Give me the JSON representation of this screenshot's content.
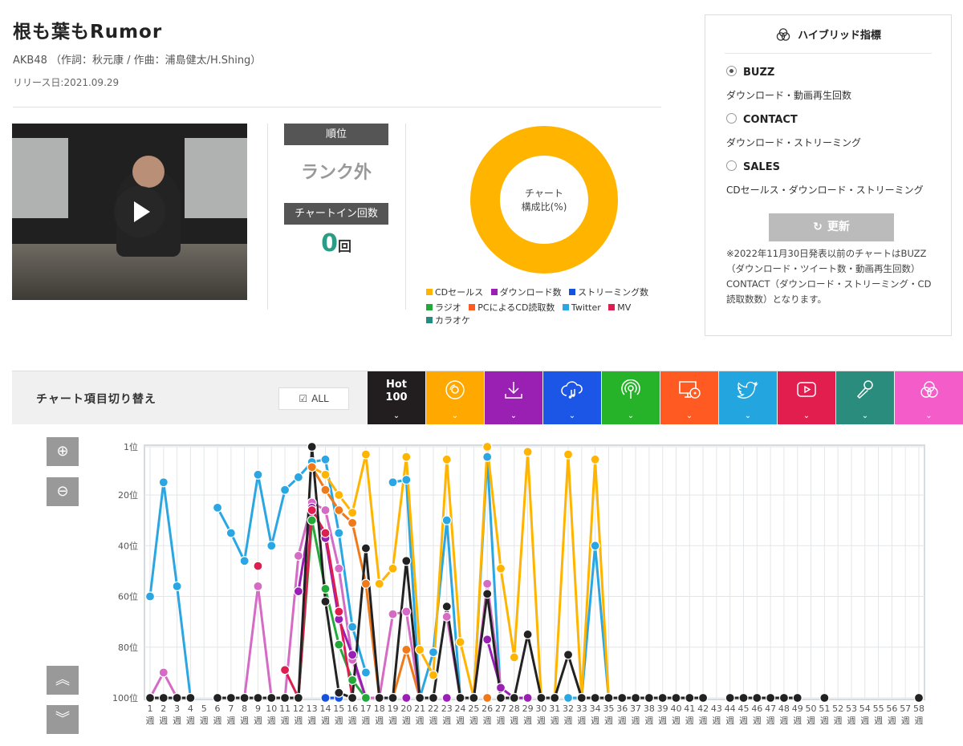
{
  "song": {
    "title": "根も葉もRumor",
    "artist_line": "AKB48 （作詞：秋元康 / 作曲：浦島健太/H.Shing）",
    "release": "リリース日:2021.09.29"
  },
  "rank": {
    "header": "順位",
    "value": "ランク外",
    "count_header": "チャートイン回数",
    "count": "0",
    "count_unit": "回"
  },
  "composition": {
    "label1": "チャート",
    "label2": "構成比(%)",
    "ring_color": "#ffb400",
    "legend": [
      {
        "label": "CDセールス",
        "color": "#ffb400"
      },
      {
        "label": "ダウンロード数",
        "color": "#9b1fb5"
      },
      {
        "label": "ストリーミング数",
        "color": "#1652e0"
      },
      {
        "label": "ラジオ",
        "color": "#23a83a"
      },
      {
        "label": "PCによるCD読取数",
        "color": "#ff5a1f"
      },
      {
        "label": "Twitter",
        "color": "#2aa7e2"
      },
      {
        "label": "MV",
        "color": "#de1d50"
      },
      {
        "label": "カラオケ",
        "color": "#248c7e"
      }
    ]
  },
  "hybrid": {
    "title": "ハイブリッド指標",
    "options": [
      {
        "label": "BUZZ",
        "desc": "ダウンロード・動画再生回数",
        "selected": true
      },
      {
        "label": "CONTACT",
        "desc": "ダウンロード・ストリーミング",
        "selected": false
      },
      {
        "label": "SALES",
        "desc": "CDセールス・ダウンロード・ストリーミング",
        "selected": false
      }
    ],
    "refresh_label": "更新",
    "note": "※2022年11月30日発表以前のチャートはBUZZ（ダウンロード・ツイート数・動画再生回数）CONTACT（ダウンロード・ストリーミング・CD読取数数）となります。"
  },
  "switcher": {
    "label": "チャート項目切り替え",
    "all_label": "ALL",
    "all_checked": true,
    "tabs": [
      {
        "name": "tab-hot100",
        "title": "Hot",
        "sub": "100",
        "color": "#221e1f",
        "icon": "hot100-text"
      },
      {
        "name": "tab-cd-sales",
        "title": "",
        "sub": "",
        "color": "#ffa800",
        "icon": "disc-icon"
      },
      {
        "name": "tab-download",
        "title": "",
        "sub": "",
        "color": "#9a1fb3",
        "icon": "download-icon"
      },
      {
        "name": "tab-streaming",
        "title": "",
        "sub": "",
        "color": "#1b56e6",
        "icon": "cloud-music-icon"
      },
      {
        "name": "tab-radio",
        "title": "",
        "sub": "",
        "color": "#27b329",
        "icon": "radio-icon"
      },
      {
        "name": "tab-pc-cd",
        "title": "",
        "sub": "",
        "color": "#ff5a22",
        "icon": "pc-disc-icon"
      },
      {
        "name": "tab-twitter",
        "title": "",
        "sub": "",
        "color": "#23a6e0",
        "icon": "twitter-icon"
      },
      {
        "name": "tab-mv",
        "title": "",
        "sub": "",
        "color": "#e21e4f",
        "icon": "play-icon"
      },
      {
        "name": "tab-karaoke",
        "title": "",
        "sub": "",
        "color": "#2a8c7c",
        "icon": "microphone-icon"
      },
      {
        "name": "tab-hybrid",
        "title": "",
        "sub": "",
        "color": "#f35cc9",
        "icon": "hybrid-icon"
      }
    ]
  },
  "chart_data": {
    "type": "line",
    "y_ticks": [
      "1位",
      "20位",
      "40位",
      "60位",
      "80位",
      "100位"
    ],
    "y_tick_values": [
      1,
      20,
      40,
      60,
      80,
      100
    ],
    "ylim": [
      1,
      100
    ],
    "y_inverted": true,
    "x_unit": "週",
    "x": [
      1,
      2,
      3,
      4,
      5,
      6,
      7,
      8,
      9,
      10,
      11,
      12,
      13,
      14,
      15,
      16,
      17,
      18,
      19,
      20,
      21,
      22,
      23,
      24,
      25,
      26,
      27,
      28,
      29,
      30,
      31,
      32,
      33,
      34,
      35,
      36,
      37,
      38,
      39,
      40,
      41,
      42,
      43,
      44,
      45,
      46,
      47,
      48,
      49,
      50,
      51,
      52,
      53,
      54,
      55,
      56,
      57,
      58
    ],
    "grid": true,
    "series": [
      {
        "name": "Twitter",
        "color": "#2aa7e2",
        "points": [
          [
            1,
            60
          ],
          [
            2,
            15
          ],
          [
            3,
            56
          ],
          [
            4,
            100
          ],
          [
            6,
            25
          ],
          [
            7,
            35
          ],
          [
            8,
            46
          ],
          [
            9,
            12
          ],
          [
            10,
            40
          ],
          [
            11,
            18
          ],
          [
            12,
            13
          ],
          [
            13,
            7
          ],
          [
            14,
            6
          ],
          [
            15,
            35
          ],
          [
            16,
            72
          ],
          [
            17,
            90
          ],
          [
            19,
            15
          ],
          [
            20,
            14
          ],
          [
            21,
            100
          ],
          [
            22,
            82
          ],
          [
            23,
            30
          ],
          [
            24,
            100
          ],
          [
            25,
            100
          ],
          [
            26,
            5
          ],
          [
            27,
            100
          ],
          [
            32,
            100
          ],
          [
            33,
            100
          ],
          [
            34,
            40
          ],
          [
            35,
            100
          ]
        ]
      },
      {
        "name": "CDセールス",
        "color": "#ffb400",
        "points": [
          [
            13,
            9
          ],
          [
            14,
            12
          ],
          [
            15,
            20
          ],
          [
            16,
            27
          ],
          [
            17,
            4
          ],
          [
            18,
            55
          ],
          [
            19,
            49
          ],
          [
            20,
            5
          ],
          [
            21,
            81
          ],
          [
            22,
            91
          ],
          [
            23,
            6
          ],
          [
            24,
            78
          ],
          [
            25,
            100
          ],
          [
            26,
            1
          ],
          [
            27,
            49
          ],
          [
            28,
            84
          ],
          [
            29,
            3
          ],
          [
            30,
            100
          ],
          [
            31,
            100
          ],
          [
            32,
            4
          ],
          [
            33,
            100
          ],
          [
            34,
            6
          ],
          [
            35,
            100
          ]
        ]
      },
      {
        "name": "PCによるCD読取数",
        "color": "#f07a1a",
        "points": [
          [
            13,
            9
          ],
          [
            14,
            18
          ],
          [
            15,
            26
          ],
          [
            16,
            31
          ],
          [
            17,
            55
          ],
          [
            18,
            100
          ],
          [
            19,
            100
          ],
          [
            20,
            81
          ],
          [
            21,
            100
          ],
          [
            26,
            100
          ]
        ]
      },
      {
        "name": "カラオケ",
        "color": "#d56bc5",
        "points": [
          [
            1,
            100
          ],
          [
            2,
            90
          ],
          [
            3,
            100
          ],
          [
            8,
            100
          ],
          [
            9,
            56
          ],
          [
            10,
            100
          ],
          [
            11,
            100
          ],
          [
            12,
            44
          ],
          [
            13,
            23
          ],
          [
            14,
            26
          ],
          [
            15,
            49
          ],
          [
            16,
            85
          ],
          [
            17,
            100
          ],
          [
            18,
            100
          ],
          [
            19,
            67
          ],
          [
            20,
            66
          ],
          [
            21,
            100
          ],
          [
            23,
            68
          ],
          [
            24,
            100
          ],
          [
            25,
            100
          ],
          [
            26,
            55
          ],
          [
            27,
            96
          ]
        ]
      },
      {
        "name": "ダウンロード数",
        "color": "#9b1fb5",
        "points": [
          [
            12,
            58
          ],
          [
            13,
            25
          ],
          [
            14,
            37
          ],
          [
            15,
            69
          ],
          [
            16,
            83
          ],
          [
            17,
            100
          ],
          [
            20,
            100
          ],
          [
            23,
            100
          ],
          [
            26,
            77
          ],
          [
            27,
            96
          ],
          [
            28,
            100
          ],
          [
            29,
            100
          ]
        ]
      },
      {
        "name": "ラジオ",
        "color": "#23a83a",
        "points": [
          [
            12,
            100
          ],
          [
            13,
            30
          ],
          [
            14,
            57
          ],
          [
            15,
            79
          ],
          [
            16,
            93
          ],
          [
            17,
            100
          ]
        ]
      },
      {
        "name": "MV",
        "color": "#de1d50",
        "points": [
          [
            9,
            48
          ],
          [
            11,
            89
          ],
          [
            12,
            100
          ],
          [
            13,
            26
          ],
          [
            14,
            35
          ],
          [
            15,
            66
          ],
          [
            16,
            100
          ]
        ]
      },
      {
        "name": "ストリーミング数",
        "color": "#1652e0",
        "points": [
          [
            14,
            100
          ],
          [
            15,
            100
          ]
        ]
      },
      {
        "name": "Hot 100",
        "color": "#222222",
        "points": [
          [
            1,
            100
          ],
          [
            2,
            100
          ],
          [
            3,
            100
          ],
          [
            4,
            100
          ],
          [
            6,
            100
          ],
          [
            7,
            100
          ],
          [
            8,
            100
          ],
          [
            9,
            100
          ],
          [
            10,
            100
          ],
          [
            11,
            100
          ],
          [
            12,
            100
          ],
          [
            13,
            1
          ],
          [
            14,
            62
          ],
          [
            15,
            98
          ],
          [
            16,
            100
          ],
          [
            17,
            41
          ],
          [
            18,
            100
          ],
          [
            19,
            100
          ],
          [
            20,
            46
          ],
          [
            21,
            100
          ],
          [
            22,
            100
          ],
          [
            23,
            64
          ],
          [
            24,
            100
          ],
          [
            25,
            100
          ],
          [
            26,
            59
          ],
          [
            27,
            100
          ],
          [
            28,
            100
          ],
          [
            29,
            75
          ],
          [
            30,
            100
          ],
          [
            31,
            100
          ],
          [
            32,
            83
          ],
          [
            33,
            100
          ],
          [
            34,
            100
          ],
          [
            35,
            100
          ],
          [
            36,
            100
          ],
          [
            37,
            100
          ],
          [
            38,
            100
          ],
          [
            39,
            100
          ],
          [
            40,
            100
          ],
          [
            41,
            100
          ],
          [
            42,
            100
          ],
          [
            44,
            100
          ],
          [
            45,
            100
          ],
          [
            46,
            100
          ],
          [
            47,
            100
          ],
          [
            48,
            100
          ],
          [
            49,
            100
          ],
          [
            51,
            100
          ],
          [
            58,
            100
          ]
        ]
      }
    ]
  }
}
